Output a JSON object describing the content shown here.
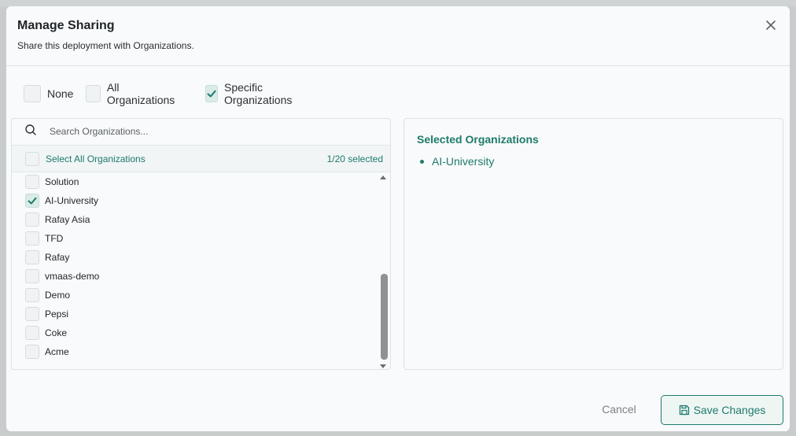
{
  "dialog": {
    "title": "Manage Sharing",
    "subtitle": "Share this deployment with Organizations."
  },
  "sharing_modes": [
    {
      "label": "None",
      "checked": false
    },
    {
      "label": "All Organizations",
      "checked": false
    },
    {
      "label": "Specific Organizations",
      "checked": true
    }
  ],
  "search": {
    "placeholder": "Search Organizations...",
    "value": ""
  },
  "select_all": {
    "label": "Select All Organizations",
    "count": "1/20 selected",
    "checked": false
  },
  "organizations": [
    {
      "name": "Solution",
      "checked": false
    },
    {
      "name": "AI-University",
      "checked": true
    },
    {
      "name": "Rafay Asia",
      "checked": false
    },
    {
      "name": "TFD",
      "checked": false
    },
    {
      "name": "Rafay",
      "checked": false
    },
    {
      "name": "vmaas-demo",
      "checked": false
    },
    {
      "name": "Demo",
      "checked": false
    },
    {
      "name": "Pepsi",
      "checked": false
    },
    {
      "name": "Coke",
      "checked": false
    },
    {
      "name": "Acme",
      "checked": false
    }
  ],
  "selected_panel": {
    "title": "Selected Organizations",
    "items": [
      "AI-University"
    ]
  },
  "footer": {
    "cancel_label": "Cancel",
    "save_label": "Save Changes"
  },
  "icons": {
    "close": "close-icon",
    "search": "search-icon",
    "check": "check-icon",
    "save": "floppy-disk-icon"
  },
  "colors": {
    "accent": "#1f7a6c",
    "checkbox_checked_bg": "#d9ece8",
    "modal_bg": "#f8fafb"
  }
}
